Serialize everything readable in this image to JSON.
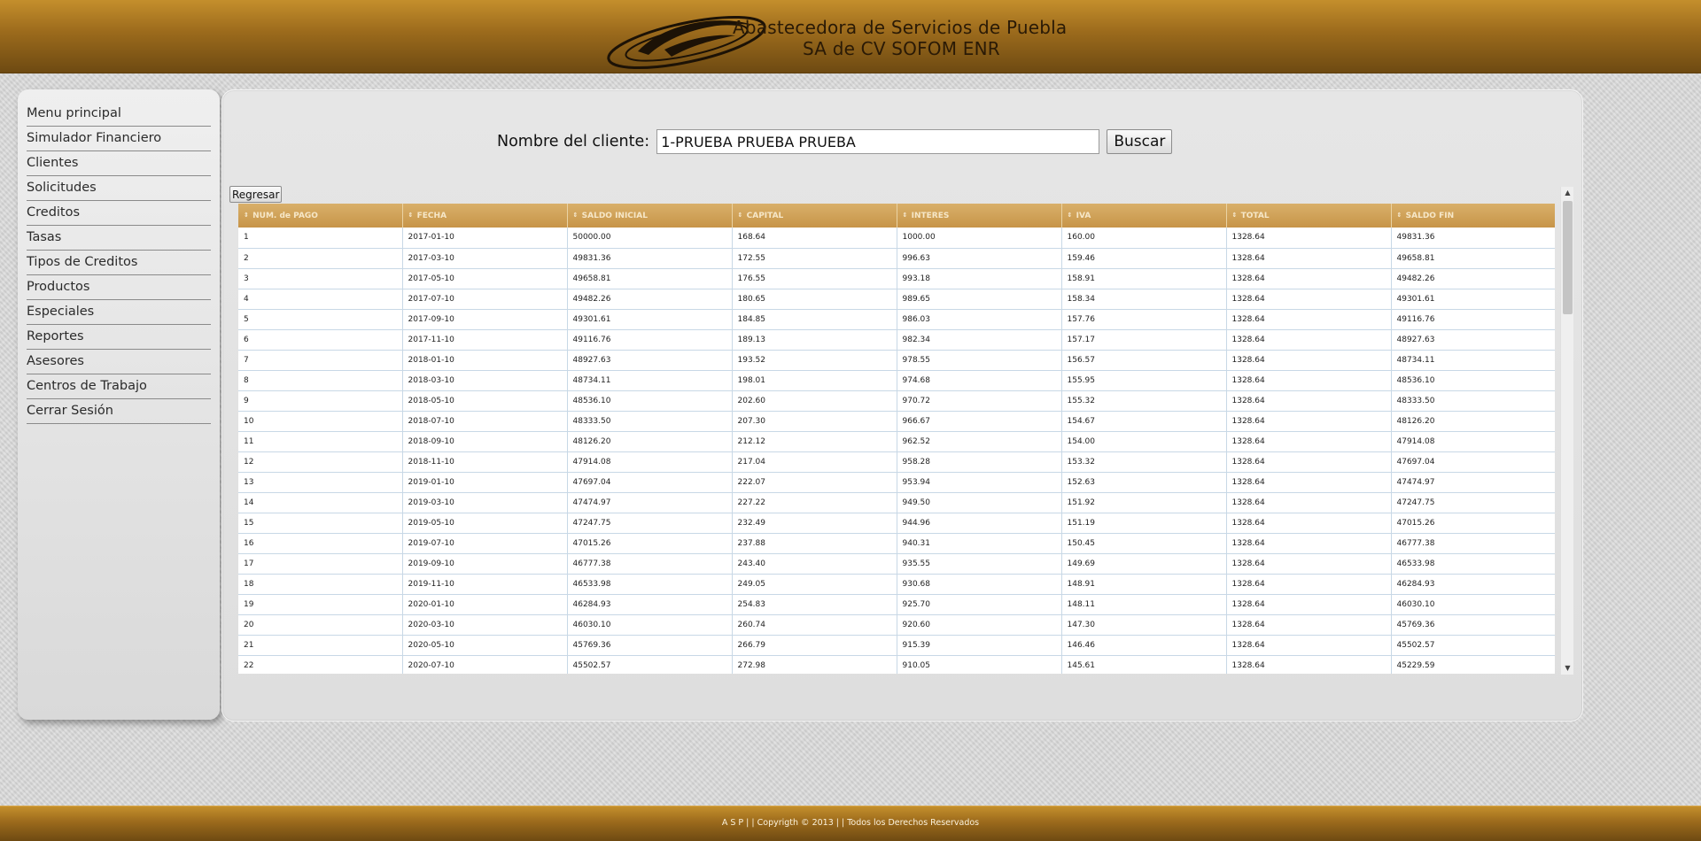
{
  "header": {
    "brand_line1": "Abastecedora de Servicios de Puebla",
    "brand_line2": "SA de CV SOFOM ENR",
    "logo_icon": "swoosh-logo-icon"
  },
  "sidebar": {
    "items": [
      {
        "label": "Menu principal"
      },
      {
        "label": "Simulador Financiero"
      },
      {
        "label": "Clientes"
      },
      {
        "label": "Solicitudes"
      },
      {
        "label": "Creditos"
      },
      {
        "label": "Tasas"
      },
      {
        "label": "Tipos de Creditos"
      },
      {
        "label": "Productos"
      },
      {
        "label": "Especiales"
      },
      {
        "label": "Reportes"
      },
      {
        "label": "Asesores"
      },
      {
        "label": "Centros de Trabajo"
      },
      {
        "label": "Cerrar Sesión"
      }
    ]
  },
  "search": {
    "label": "Nombre del cliente:",
    "value": "1-PRUEBA PRUEBA PRUEBA",
    "button_label": "Buscar"
  },
  "back_label": "Regresar",
  "table": {
    "columns": [
      "NUM. de PAGO",
      "FECHA",
      "SALDO INICIAL",
      "CAPITAL",
      "INTERES",
      "IVA",
      "TOTAL",
      "SALDO FIN"
    ],
    "rows": [
      [
        "1",
        "2017-01-10",
        "50000.00",
        "168.64",
        "1000.00",
        "160.00",
        "1328.64",
        "49831.36"
      ],
      [
        "2",
        "2017-03-10",
        "49831.36",
        "172.55",
        "996.63",
        "159.46",
        "1328.64",
        "49658.81"
      ],
      [
        "3",
        "2017-05-10",
        "49658.81",
        "176.55",
        "993.18",
        "158.91",
        "1328.64",
        "49482.26"
      ],
      [
        "4",
        "2017-07-10",
        "49482.26",
        "180.65",
        "989.65",
        "158.34",
        "1328.64",
        "49301.61"
      ],
      [
        "5",
        "2017-09-10",
        "49301.61",
        "184.85",
        "986.03",
        "157.76",
        "1328.64",
        "49116.76"
      ],
      [
        "6",
        "2017-11-10",
        "49116.76",
        "189.13",
        "982.34",
        "157.17",
        "1328.64",
        "48927.63"
      ],
      [
        "7",
        "2018-01-10",
        "48927.63",
        "193.52",
        "978.55",
        "156.57",
        "1328.64",
        "48734.11"
      ],
      [
        "8",
        "2018-03-10",
        "48734.11",
        "198.01",
        "974.68",
        "155.95",
        "1328.64",
        "48536.10"
      ],
      [
        "9",
        "2018-05-10",
        "48536.10",
        "202.60",
        "970.72",
        "155.32",
        "1328.64",
        "48333.50"
      ],
      [
        "10",
        "2018-07-10",
        "48333.50",
        "207.30",
        "966.67",
        "154.67",
        "1328.64",
        "48126.20"
      ],
      [
        "11",
        "2018-09-10",
        "48126.20",
        "212.12",
        "962.52",
        "154.00",
        "1328.64",
        "47914.08"
      ],
      [
        "12",
        "2018-11-10",
        "47914.08",
        "217.04",
        "958.28",
        "153.32",
        "1328.64",
        "47697.04"
      ],
      [
        "13",
        "2019-01-10",
        "47697.04",
        "222.07",
        "953.94",
        "152.63",
        "1328.64",
        "47474.97"
      ],
      [
        "14",
        "2019-03-10",
        "47474.97",
        "227.22",
        "949.50",
        "151.92",
        "1328.64",
        "47247.75"
      ],
      [
        "15",
        "2019-05-10",
        "47247.75",
        "232.49",
        "944.96",
        "151.19",
        "1328.64",
        "47015.26"
      ],
      [
        "16",
        "2019-07-10",
        "47015.26",
        "237.88",
        "940.31",
        "150.45",
        "1328.64",
        "46777.38"
      ],
      [
        "17",
        "2019-09-10",
        "46777.38",
        "243.40",
        "935.55",
        "149.69",
        "1328.64",
        "46533.98"
      ],
      [
        "18",
        "2019-11-10",
        "46533.98",
        "249.05",
        "930.68",
        "148.91",
        "1328.64",
        "46284.93"
      ],
      [
        "19",
        "2020-01-10",
        "46284.93",
        "254.83",
        "925.70",
        "148.11",
        "1328.64",
        "46030.10"
      ],
      [
        "20",
        "2020-03-10",
        "46030.10",
        "260.74",
        "920.60",
        "147.30",
        "1328.64",
        "45769.36"
      ],
      [
        "21",
        "2020-05-10",
        "45769.36",
        "266.79",
        "915.39",
        "146.46",
        "1328.64",
        "45502.57"
      ],
      [
        "22",
        "2020-07-10",
        "45502.57",
        "272.98",
        "910.05",
        "145.61",
        "1328.64",
        "45229.59"
      ]
    ]
  },
  "footer": {
    "text": "A S P  | |  Copyrigth © 2013  | |  Todos los Derechos Reservados"
  },
  "colors": {
    "header_gold": "#c48f2c",
    "header_dark": "#6e4a12",
    "table_header": "#d9b06a",
    "grid_line": "#c8d8e6"
  }
}
